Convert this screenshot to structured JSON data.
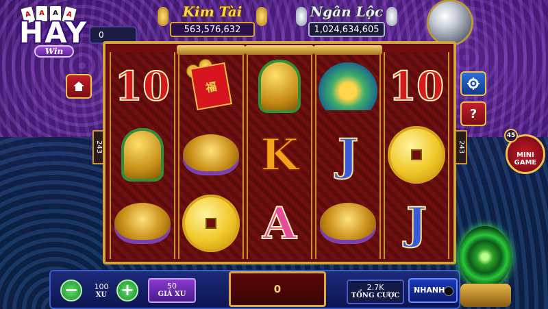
{
  "brand": {
    "logo_text": "HAY",
    "logo_sub": "Win"
  },
  "balance_pill": "0",
  "jackpots": [
    {
      "title": "Kim Tài",
      "value": "563,576,632"
    },
    {
      "title": "Ngân Lộc",
      "value": "1,024,634,605"
    }
  ],
  "reels": [
    [
      "10",
      "lion",
      "turtle"
    ],
    [
      "envelope",
      "turtle",
      "coin"
    ],
    [
      "lion",
      "K",
      "A"
    ],
    [
      "phoenix",
      "J",
      "turtle"
    ],
    [
      "10",
      "coin",
      "J"
    ]
  ],
  "envelope_char": "福",
  "ways_left": "243",
  "ways_right": "243",
  "side_buttons": {
    "home": "home-icon",
    "settings": "gear-icon",
    "help": "?"
  },
  "mini_game": {
    "line1": "MINI",
    "line2": "GAME",
    "badge": "45"
  },
  "bottom": {
    "minus": "−",
    "plus": "+",
    "xu_value": "100",
    "xu_label": "XU",
    "gia_xu_value": "50",
    "gia_xu_label": "GIÁ XU",
    "win": "0",
    "tong_cuoc_value": "2.7K",
    "tong_cuoc_label": "TỔNG CƯỢC",
    "speed_label": "NHANH"
  }
}
